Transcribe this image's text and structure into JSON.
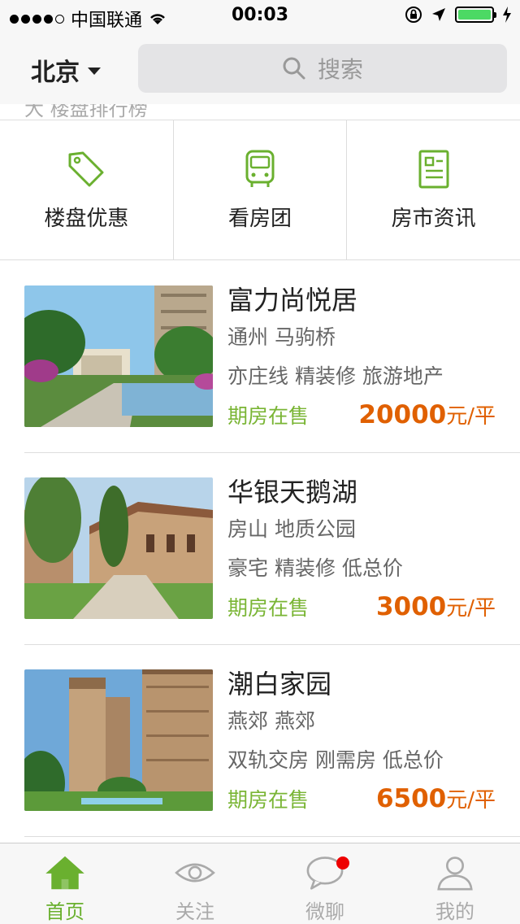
{
  "status_bar": {
    "carrier": "中国联通",
    "time": "00:03"
  },
  "header": {
    "city": "北京",
    "search_placeholder": "搜索"
  },
  "peek_text": "大  楼盘排行榜",
  "categories": [
    {
      "label": "楼盘优惠",
      "icon": "tag-icon"
    },
    {
      "label": "看房团",
      "icon": "bus-icon"
    },
    {
      "label": "房市资讯",
      "icon": "news-icon"
    }
  ],
  "listings": [
    {
      "name": "富力尚悦居",
      "location": "通州 马驹桥",
      "tags": "亦庄线 精装修 旅游地产",
      "status": "期房在售",
      "price": "20000",
      "unit": "元/平"
    },
    {
      "name": "华银天鹅湖",
      "location": "房山 地质公园",
      "tags": "豪宅 精装修 低总价",
      "status": "期房在售",
      "price": "3000",
      "unit": "元/平"
    },
    {
      "name": "潮白家园",
      "location": "燕郊 燕郊",
      "tags": "双轨交房 刚需房 低总价",
      "status": "期房在售",
      "price": "6500",
      "unit": "元/平"
    }
  ],
  "tabs": [
    {
      "label": "首页",
      "icon": "home-icon",
      "active": true
    },
    {
      "label": "关注",
      "icon": "eye-icon",
      "active": false
    },
    {
      "label": "微聊",
      "icon": "chat-bubble-icon",
      "active": false,
      "badge": true
    },
    {
      "label": "我的",
      "icon": "user-icon",
      "active": false
    }
  ],
  "colors": {
    "accent_green": "#6ab02f",
    "price_orange": "#e06000",
    "badge_red": "#e00000"
  }
}
